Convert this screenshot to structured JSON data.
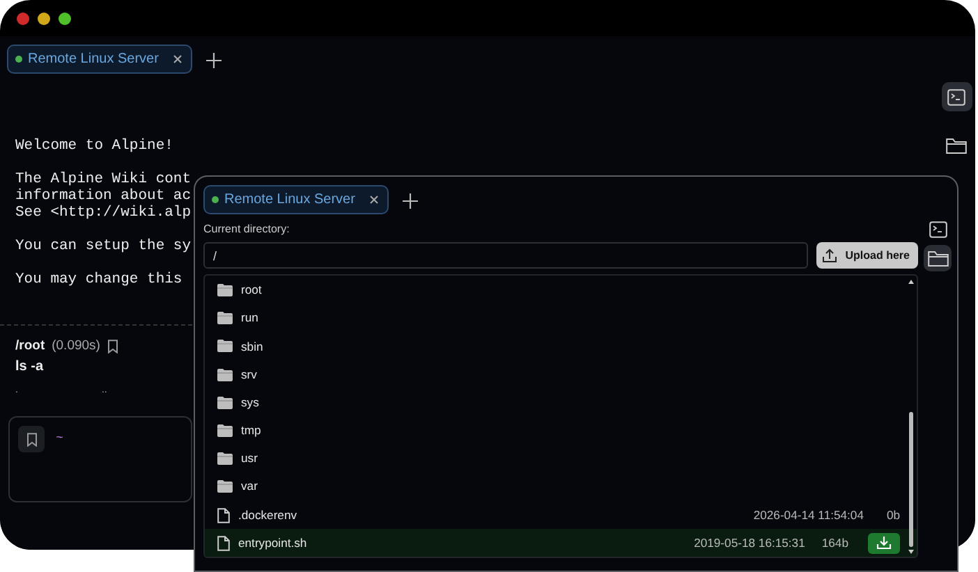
{
  "window": {
    "tabs": [
      {
        "label": "Remote Linux Server",
        "connected": true,
        "selected": true
      }
    ],
    "sidebar": [
      {
        "kind": "terminal",
        "selected": true
      },
      {
        "kind": "folder",
        "selected": false
      }
    ],
    "terminal": {
      "paragraphs": [
        [
          "Welcome to Alpine!"
        ],
        [
          "The Alpine Wiki cont",
          "information about ac",
          "See <http://wiki.alp"
        ],
        [
          "You can setup the sy"
        ],
        [
          "You may change this"
        ]
      ],
      "last_command": {
        "path": "/root",
        "duration": "(0.090s)",
        "command": "ls -a",
        "output": [
          ".",
          ".."
        ]
      },
      "prompt": "~"
    }
  },
  "file_window": {
    "tabs": [
      {
        "label": "Remote Linux Server",
        "connected": true,
        "selected": true
      }
    ],
    "sidebar": [
      {
        "kind": "terminal",
        "selected": false
      },
      {
        "kind": "folder",
        "selected": true
      }
    ],
    "directory_label": "Current directory:",
    "directory": "/",
    "upload_button": "Upload here",
    "files": [
      {
        "kind": "folder",
        "name": "root",
        "selected": false
      },
      {
        "kind": "folder",
        "name": "run",
        "selected": false
      },
      {
        "kind": "folder",
        "name": "sbin",
        "selected": false
      },
      {
        "kind": "folder",
        "name": "srv",
        "selected": false
      },
      {
        "kind": "folder",
        "name": "sys",
        "selected": false
      },
      {
        "kind": "folder",
        "name": "tmp",
        "selected": false
      },
      {
        "kind": "folder",
        "name": "usr",
        "selected": false
      },
      {
        "kind": "folder",
        "name": "var",
        "selected": false
      },
      {
        "kind": "file",
        "name": ".dockerenv",
        "modified": "2026-04-14 11:54:04",
        "size": "0b",
        "selected": false
      },
      {
        "kind": "file",
        "name": "entrypoint.sh",
        "modified": "2019-05-18 16:15:31",
        "size": "164b",
        "selected": true
      }
    ]
  }
}
